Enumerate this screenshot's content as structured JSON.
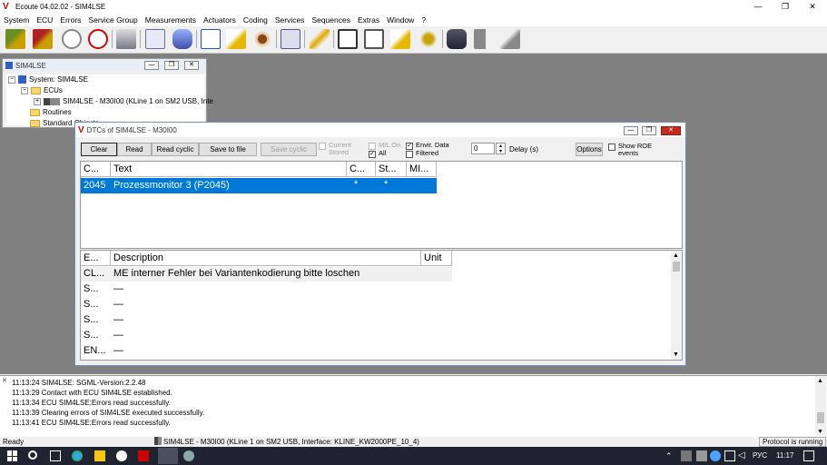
{
  "app": {
    "title": "Ecoute 04.02.02 - SIM4LSE",
    "logo": "V"
  },
  "window_controls": {
    "minimize": "—",
    "maximize": "❐",
    "close": "✕"
  },
  "menu": [
    "System",
    "ECU",
    "Errors",
    "Service Group",
    "Measurements",
    "Actuators",
    "Coding",
    "Services",
    "Sequences",
    "Extras",
    "Window",
    "?"
  ],
  "toolbar": {
    "icons": [
      "connect-icon",
      "disconnect-icon",
      "check-icon",
      "no-check-icon",
      "ecu-icon",
      "report-icon",
      "car-icon",
      "measure-icon",
      "export-icon",
      "eye-icon",
      "network-icon",
      "flash-icon",
      "doc-icon",
      "table-icon",
      "edit-icon",
      "tools-icon",
      "binoculars-icon",
      "forward-icon",
      "pin-icon"
    ]
  },
  "sim_window": {
    "title": "SIM4LSE",
    "tree": {
      "system": "System: SIM4LSE",
      "ecus": "ECUs",
      "ecu": "SIM4LSE - M30I00 (KLine 1 on SM2 USB, Inte",
      "routines": "Routines",
      "standard": "Standard Objects"
    }
  },
  "dtc_window": {
    "title": "DTCs of SIM4LSE - M30I00",
    "buttons": {
      "clear": "Clear",
      "read": "Read",
      "read_cyclic": "Read cyclic",
      "save_to_file": "Save to file",
      "save_cyclic": "Save cyclic",
      "options": "Options"
    },
    "checks": {
      "current_stored_1": "Current",
      "current_stored_2": "Stored",
      "mil_on": "MIL On",
      "all": "All",
      "envir_data": "Envir. Data",
      "filtered": "Filtered",
      "show_roe_1": "Show ROE",
      "show_roe_2": "events"
    },
    "check_mark": "✓",
    "delay": {
      "value": "0",
      "label": "Delay (s)"
    },
    "dtc_table": {
      "columns": [
        "C...",
        "Text",
        "C...",
        "St...",
        "MI..."
      ],
      "rows": [
        {
          "code": "2045",
          "text": "Prozessmonitor 3 (P2045)",
          "c": "*",
          "st": "*",
          "mi": ""
        }
      ]
    },
    "detail_table": {
      "columns": [
        "E...",
        "Description",
        "Unit"
      ],
      "rows": [
        {
          "e": "CL...",
          "desc": "ME interner Fehler bei Variantenkodierung bitte loschen",
          "unit": ""
        },
        {
          "e": "S...",
          "desc": "—",
          "unit": ""
        },
        {
          "e": "S...",
          "desc": "—",
          "unit": ""
        },
        {
          "e": "S...",
          "desc": "—",
          "unit": ""
        },
        {
          "e": "S...",
          "desc": "—",
          "unit": ""
        },
        {
          "e": "EN...",
          "desc": "—",
          "unit": ""
        }
      ]
    }
  },
  "log": [
    "11:13:24 SIM4LSE: SGML-Version:2.2.48",
    "11:13:29 Contact with ECU SIM4LSE established.",
    "11:13:34 ECU SIM4LSE:Errors read successfully.",
    "11:13:39 Clearing errors of SIM4LSE executed successfully.",
    "11:13:41 ECU SIM4LSE:Errors read successfully."
  ],
  "status": {
    "left": "Ready",
    "center": "SIM4LSE - M30I00 (KLine 1 on SM2 USB, Interface: KLINE_KW2000PE_10_4)",
    "right": "Protocol is running"
  },
  "taskbar": {
    "lang": "РУС",
    "time": "11:17"
  },
  "colors": {
    "selection": "#0078d7",
    "mdi": "#808080"
  }
}
